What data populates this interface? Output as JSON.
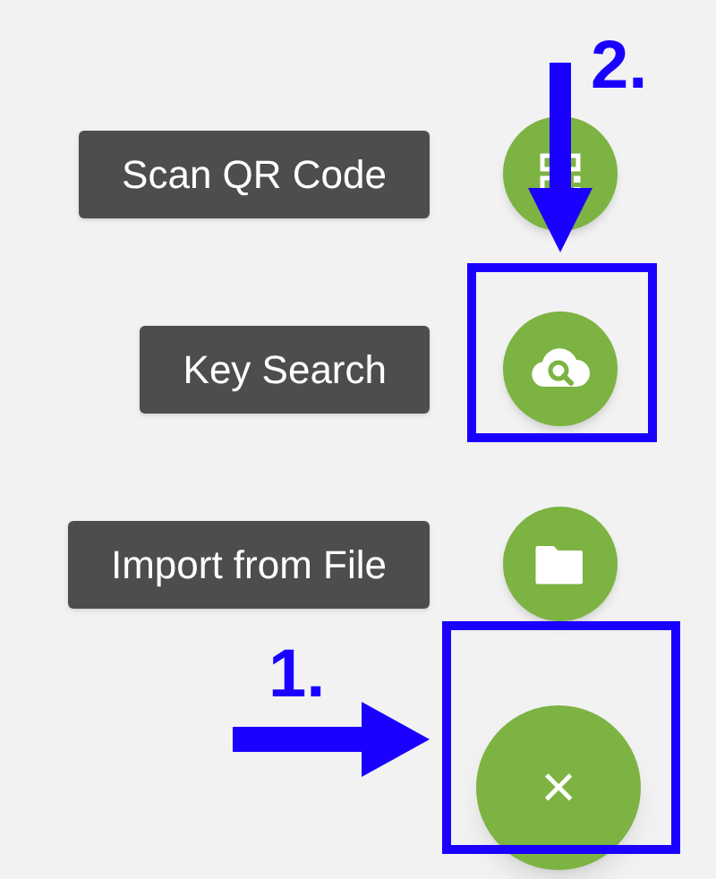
{
  "actions": [
    {
      "label": "Scan QR Code",
      "kind": "qr"
    },
    {
      "label": "Key Search",
      "kind": "cloud-search"
    },
    {
      "label": "Import from File",
      "kind": "folder"
    }
  ],
  "main_button": {
    "symbol": "×"
  },
  "annotations": [
    {
      "kind": "number",
      "text": "2."
    },
    {
      "kind": "number",
      "text": "1."
    }
  ]
}
